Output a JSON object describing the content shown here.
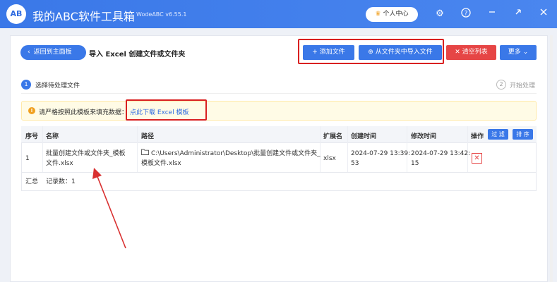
{
  "app": {
    "logo": "AB",
    "title": "我的ABC软件工具箱",
    "version": "WodeABC v6.55.1",
    "user_center": "个人中心",
    "icons": [
      "gear-icon",
      "help-icon",
      "minimize-icon",
      "close-icon"
    ]
  },
  "header": {
    "back_label": "返回到主面板",
    "page_title": "导入 Excel 创建文件或文件夹"
  },
  "toolbar": {
    "add_label": "添加文件",
    "import_label": "从文件夹中导入文件",
    "clear_label": "清空列表",
    "more_label": "更多"
  },
  "steps": [
    {
      "num": "1",
      "label": "选择待处理文件"
    },
    {
      "num": "2",
      "label": "开始处理"
    }
  ],
  "notice": {
    "text": "请严格按照此模板来填充数据：",
    "link": "点此下载 Excel 模板"
  },
  "table": {
    "headers": [
      "序号",
      "名称",
      "路径",
      "扩展名",
      "创建时间",
      "修改时间",
      "操作"
    ],
    "filter_label": "过 滤",
    "sort_label": "排 序",
    "rows": [
      {
        "index": "1",
        "name_line1": "批量创建文件或文件夹_模板",
        "name_line2": "文件.xlsx",
        "path_line1": "C:\\Users\\Administrator\\Desktop\\批量创建文件或文件夹_",
        "path_line2": "模板文件.xlsx",
        "ext": "xlsx",
        "created_line1": "2024-07-29 13:39:",
        "created_line2": "53",
        "modified_line1": "2024-07-29 13:42:",
        "modified_line2": "15"
      }
    ],
    "summary_label": "汇总",
    "summary_value": "记录数：1"
  },
  "colors": {
    "accent": "#3a78e8",
    "danger": "#e64545",
    "highlight_box": "#d92020",
    "arrow": "#d93030"
  }
}
